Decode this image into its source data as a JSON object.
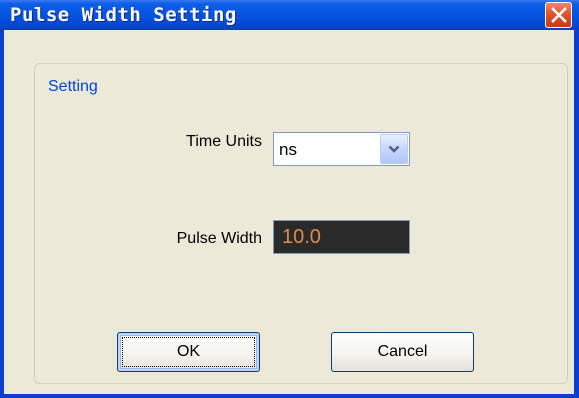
{
  "window": {
    "title": "Pulse Width Setting",
    "close_icon": "close-icon"
  },
  "group": {
    "legend": "Setting"
  },
  "time_units": {
    "label": "Time Units",
    "value": "ns",
    "dropdown_icon": "chevron-down-icon"
  },
  "pulse_width": {
    "label": "Pulse Width",
    "value": "10.0"
  },
  "buttons": {
    "ok_label": "OK",
    "cancel_label": "Cancel"
  },
  "colors": {
    "titlebar": "#0553e0",
    "close_button": "#e2512a",
    "group_legend": "#0046d5",
    "dialog_background": "#ece9d8",
    "pulse_width_field_background": "#2a2a2a",
    "pulse_width_text": "#e08a4a"
  }
}
